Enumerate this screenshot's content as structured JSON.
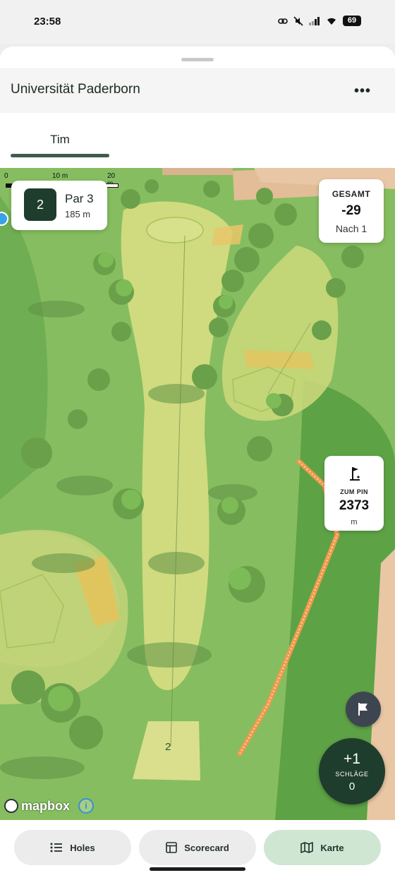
{
  "status_bar": {
    "time": "23:58",
    "battery": "69"
  },
  "header": {
    "title": "Universität Paderborn",
    "more_label": "•••"
  },
  "tabs": [
    {
      "label": "Tim"
    }
  ],
  "map": {
    "scale": {
      "zero": "0",
      "mid": "10 m",
      "end": "20 m"
    },
    "hole_card": {
      "number": "2",
      "par": "Par 3",
      "distance": "185 m"
    },
    "total_card": {
      "label": "GESAMT",
      "value": "-29",
      "sub": "Nach 1"
    },
    "pin_card": {
      "label": "ZUM PIN",
      "value": "2373",
      "unit": "m",
      "icon": "pin-flag-icon"
    },
    "tee_marker": "2",
    "stroke_button": {
      "plus": "+1",
      "label": "SCHLÄGE",
      "count": "0"
    },
    "attribution": {
      "logo": "mapbox",
      "info": "i"
    },
    "colors": {
      "grass": "#7fb85c",
      "fairway": "#d2dc82",
      "bunker": "#e9c96a",
      "path": "#f0a45a",
      "accent": "#1f3d2c"
    }
  },
  "bottom_nav": {
    "holes": "Holes",
    "scorecard": "Scorecard",
    "karte": "Karte"
  }
}
